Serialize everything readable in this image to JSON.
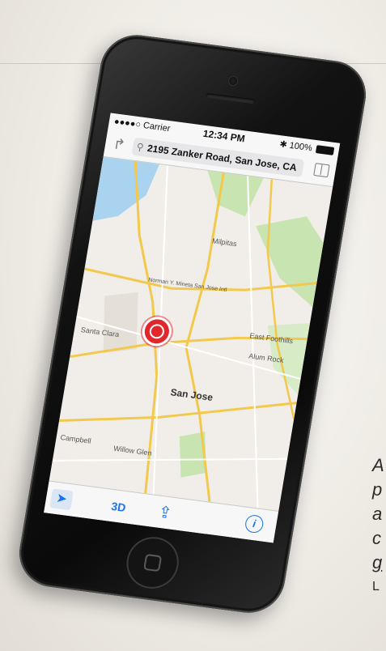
{
  "status_bar": {
    "carrier": "●●●●○ Carrier",
    "time": "12:34 PM",
    "battery": "100%"
  },
  "nav": {
    "search_value": "2195 Zanker Road, San Jose, CA"
  },
  "map": {
    "labels": {
      "milpitas": "Milpitas",
      "airport": "Norman Y. Mineta San Jose Intl",
      "santa_clara": "Santa Clara",
      "east_foothills": "East Foothills",
      "alum_rock": "Alum Rock",
      "san_jose": "San Jose",
      "campbell": "Campbell",
      "willow_glen": "Willow Glen"
    },
    "colors": {
      "land": "#f1eee9",
      "water": "#aad3f0",
      "park": "#c8e4b0",
      "highway": "#f2c94c",
      "road": "#ffffff"
    }
  },
  "toolbar": {
    "btn_3d": "3D"
  },
  "side_text": [
    "A",
    "p",
    "a",
    "c",
    "g",
    "L"
  ],
  "accent_color": "#1a73e8",
  "pin_color": "#e2272c"
}
